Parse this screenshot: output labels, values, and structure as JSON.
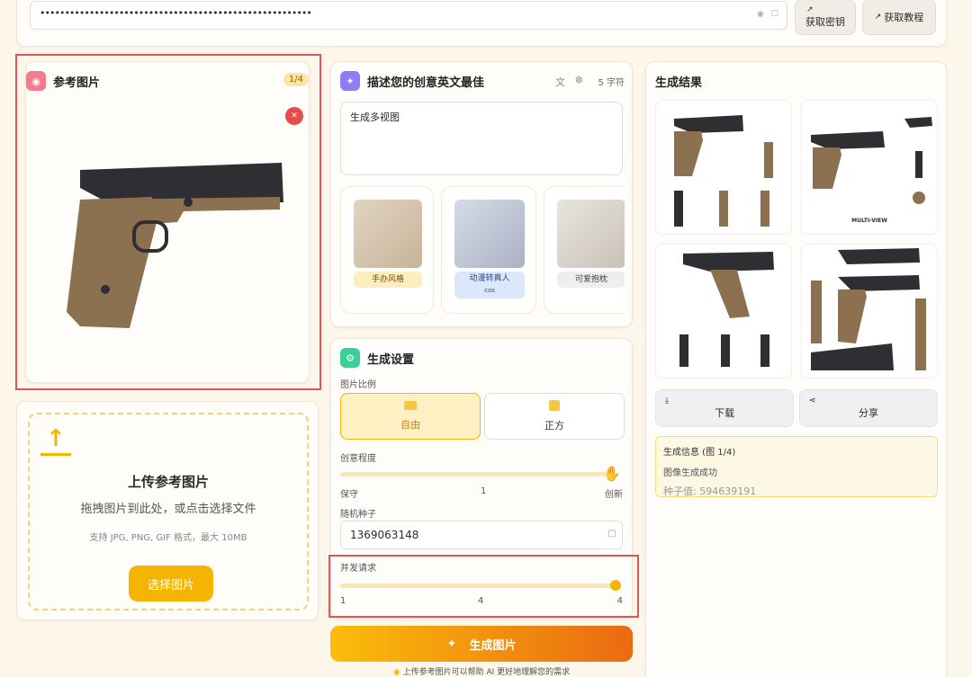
{
  "top": {
    "api_key_masked": "•••••••••••••••••••••••••••••••••••••••••••••••••••••••",
    "get_key_label": "获取密钥",
    "get_tutorial_label": "获取教程"
  },
  "reference": {
    "title": "参考图片",
    "count": "1/4"
  },
  "upload": {
    "title": "上传参考图片",
    "hint": "拖拽图片到此处，或点击选择文件",
    "formats": "支持 JPG, PNG, GIF 格式，最大 10MB",
    "button": "选择图片"
  },
  "prompt": {
    "title": "描述您的创意英文最佳",
    "char_count": "5 字符",
    "text": "生成多视图",
    "styles": [
      {
        "label": "手办风格"
      },
      {
        "label": "动漫转真人",
        "sub": "cos"
      },
      {
        "label": "可爱抱枕"
      }
    ]
  },
  "settings": {
    "title": "生成设置",
    "ratio_label": "图片比例",
    "ratio_free": "自由",
    "ratio_square": "正方",
    "creativity_label": "创意程度",
    "creativity_min": "保守",
    "creativity_value": "1",
    "creativity_max": "创新",
    "seed_label": "随机种子",
    "seed_value": "1369063148",
    "concurrency_label": "并发请求",
    "conc_min": "1",
    "conc_value": "4",
    "conc_max": "4",
    "concurrency_fraction": 1.0
  },
  "generate_button": "生成图片",
  "footer_tip": "上传参考图片可以帮助 AI 更好地理解您的需求",
  "results": {
    "title": "生成结果",
    "multi_view_label": "MULTI-VIEW",
    "download": "下载",
    "share": "分享",
    "info_title": "生成信息 (图 1/4)",
    "info_status": "图像生成成功",
    "info_seed": "种子值: 594639191"
  },
  "colors": {
    "accent": "#f4b400",
    "gun_tan": "#8c7150",
    "gun_black": "#2f2f33",
    "red_highlight": "#e25555"
  }
}
